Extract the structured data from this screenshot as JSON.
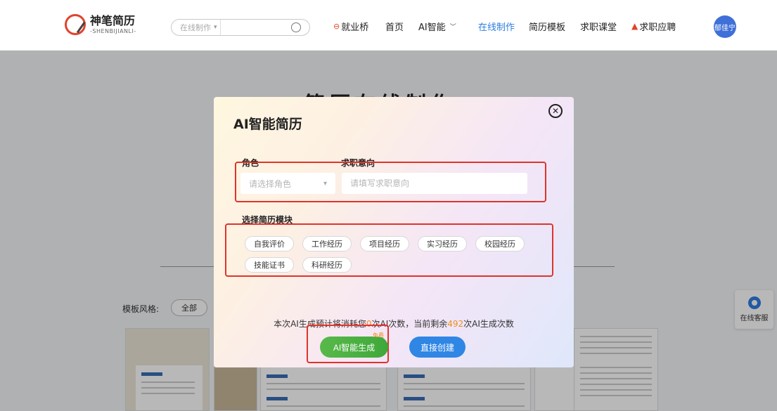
{
  "header": {
    "logo_cn": "神笔简历",
    "logo_en": "-SHENBIJIANLI-",
    "search_select": "在线制作",
    "nav": [
      {
        "label": "就业桥",
        "prefix": "⊖"
      },
      {
        "label": "首页"
      },
      {
        "label": "AI智能",
        "has_dropdown": true
      },
      {
        "label": "在线制作",
        "active": true
      },
      {
        "label": "简历模板"
      },
      {
        "label": "求职课堂"
      },
      {
        "label": "求职应聘",
        "prefix": "🔥"
      }
    ],
    "avatar_text": "郁佳宁"
  },
  "page": {
    "title": "简历在线制作",
    "style_label": "模板风格:",
    "style_all": "全部",
    "service_label": "在线客服"
  },
  "modal": {
    "title": "AI智能简历",
    "close_symbol": "✕",
    "role_label": "求职意向",
    "role_field_label": "角色",
    "role_placeholder": "请选择角色",
    "intent_placeholder": "请填写求职意向",
    "modules_label": "选择简历模块",
    "modules": [
      "自我评价",
      "工作经历",
      "项目经历",
      "实习经历",
      "校园经历",
      "技能证书",
      "科研经历"
    ],
    "cost_prefix": "本次AI生成预计将消耗您",
    "cost_value": "0",
    "cost_mid": "次AI次数，当前剩余",
    "remaining": "492",
    "cost_suffix": "次AI生成次数",
    "free_tag": "免费",
    "ai_button": "AI智能生成",
    "direct_button": "直接创建"
  },
  "colors": {
    "accent_blue": "#2f86e4",
    "accent_green": "#4fb044",
    "highlight_red": "#e0332b",
    "number_orange": "#f08c1c"
  }
}
